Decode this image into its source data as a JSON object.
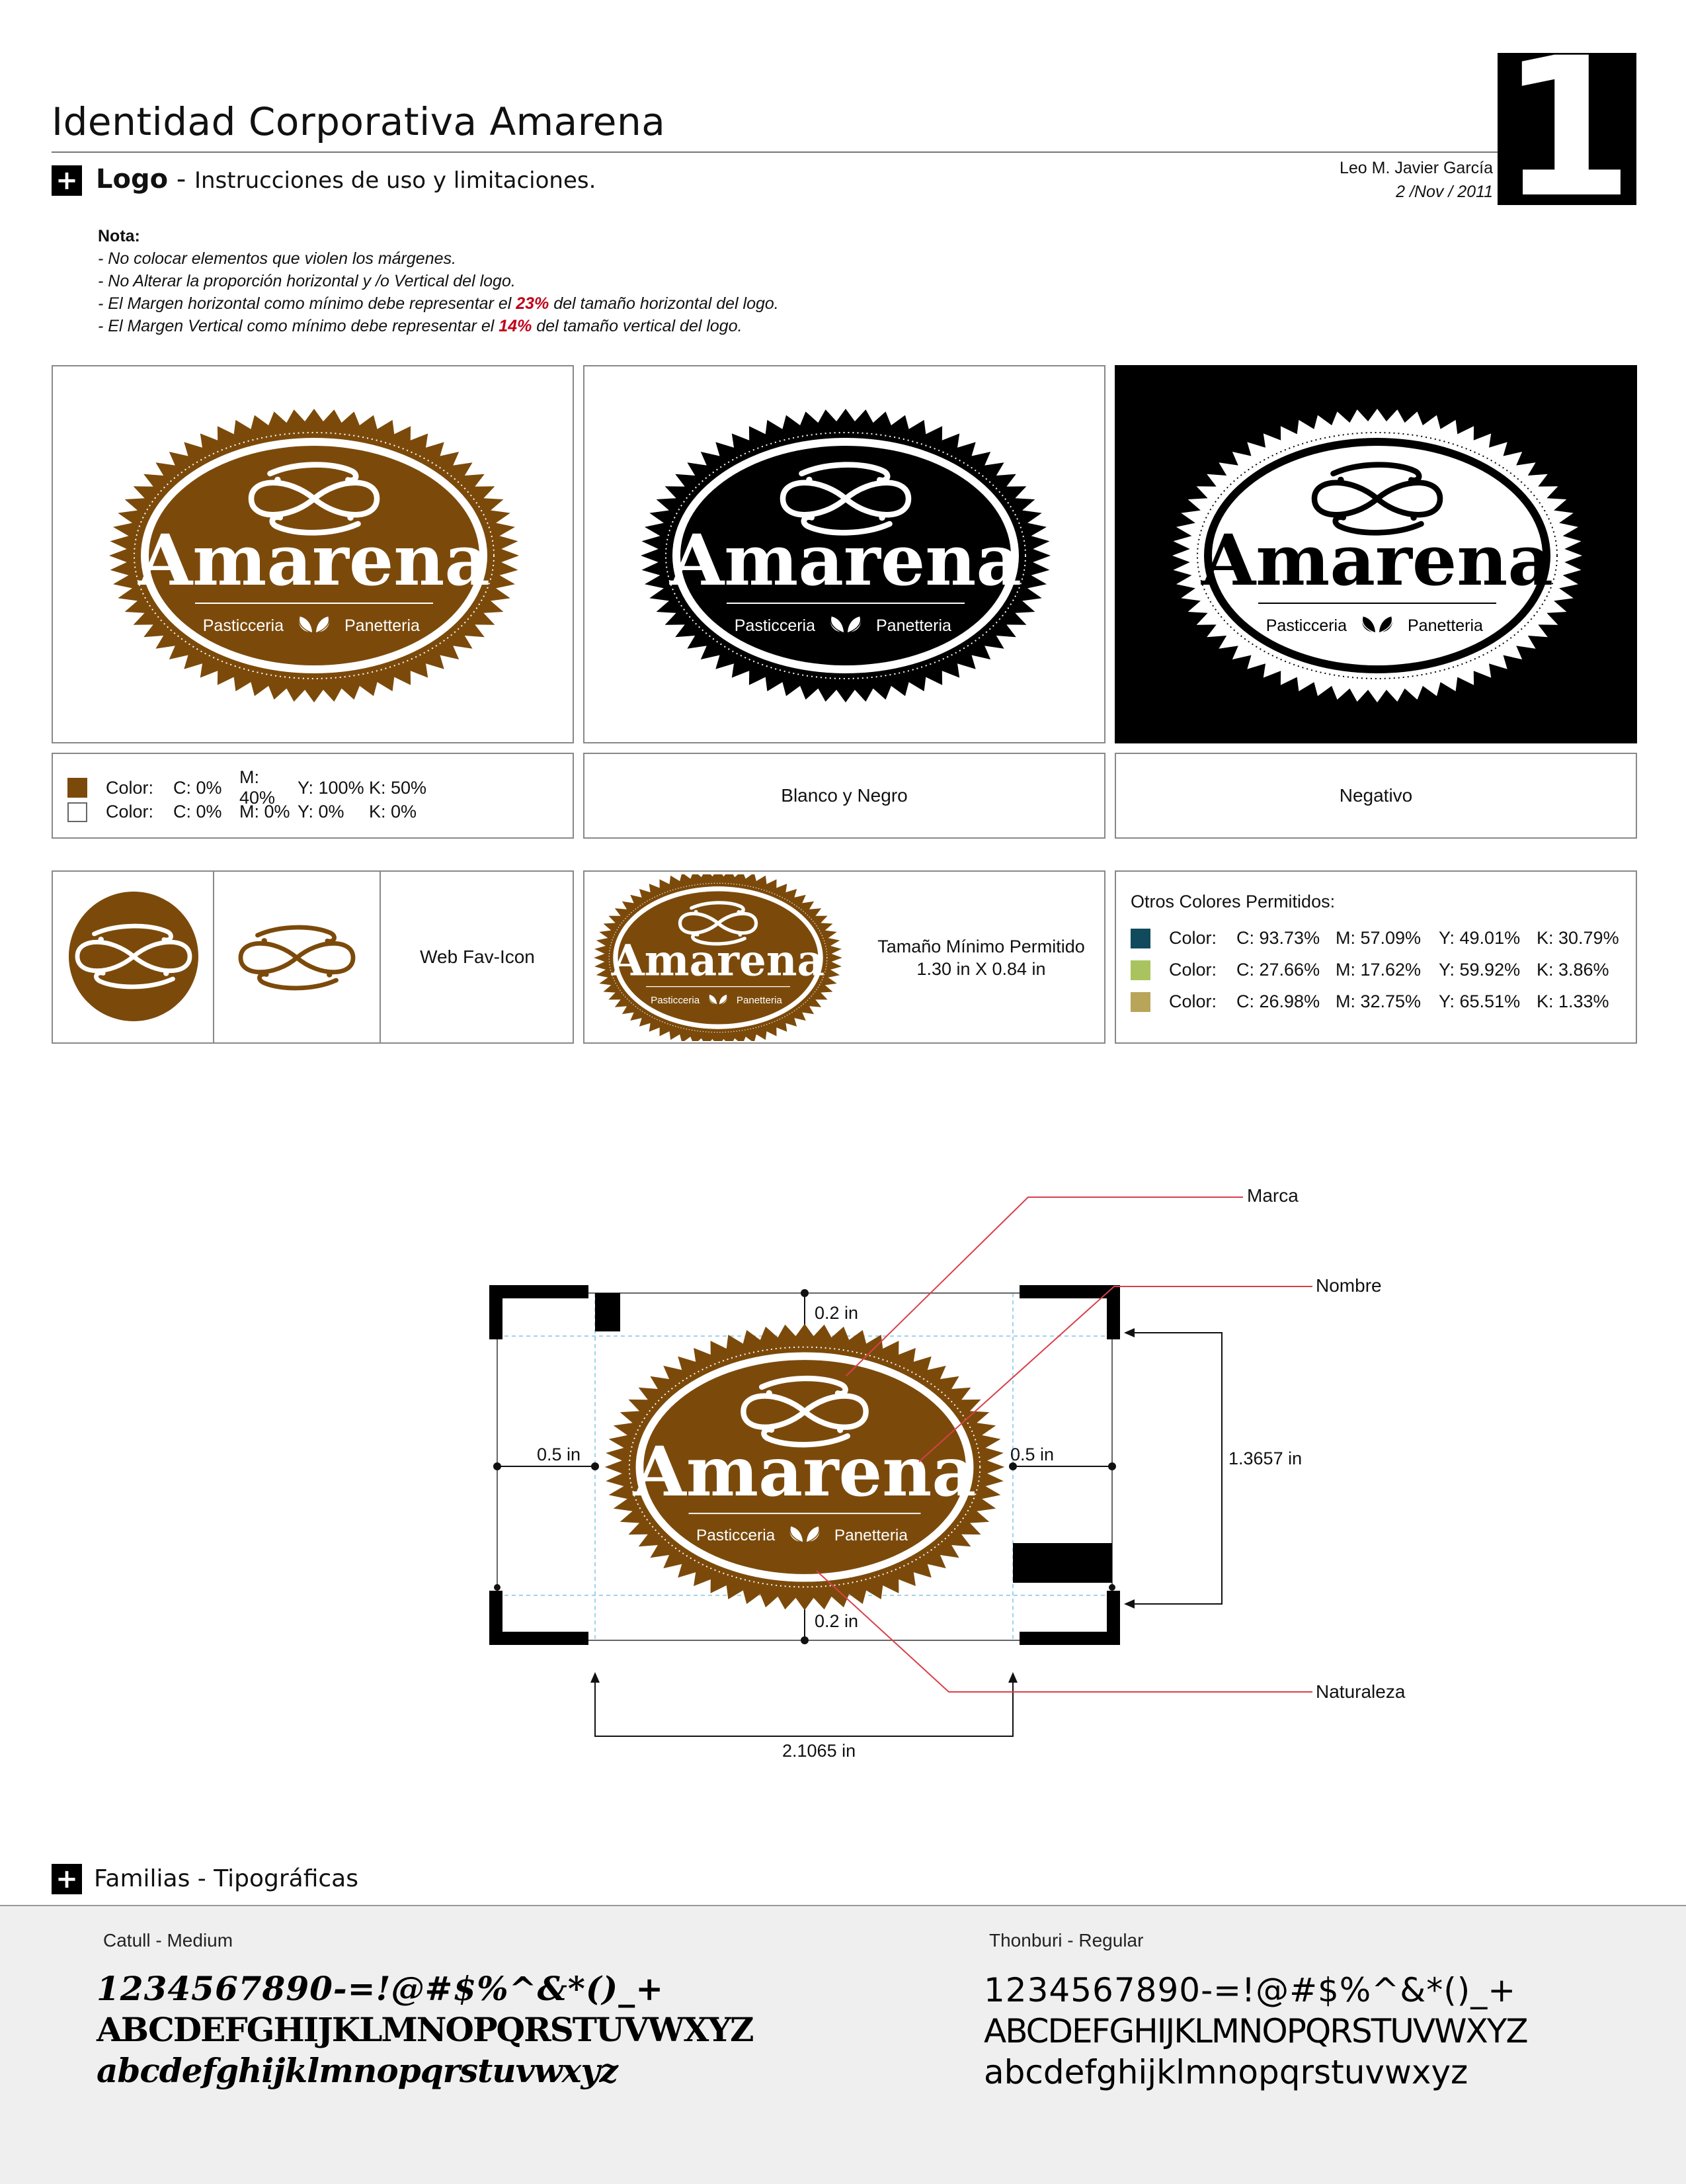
{
  "header": {
    "title": "Identidad Corporativa Amarena",
    "page_number": "1",
    "author": "Leo M. Javier García",
    "date": "2 /Nov / 2011"
  },
  "logo_section": {
    "label": "Logo",
    "separator": "-",
    "subtitle": "Instrucciones de uso y limitaciones."
  },
  "notes": {
    "heading": "Nota:",
    "line1": "- No colocar elementos que violen los márgenes.",
    "line2": "- No Alterar la proporción horizontal y /o Vertical del logo.",
    "line3_pre": "- El Margen horizontal como mínimo debe representar el ",
    "line3_pct": "23%",
    "line3_post": " del tamaño horizontal del logo.",
    "line4_pre": "- El Margen Vertical como mínimo debe representar el ",
    "line4_pct": "14%",
    "line4_post": " del tamaño vertical del logo."
  },
  "logo": {
    "name": "Amarena",
    "left_word": "Pasticceria",
    "right_word": "Panetteria"
  },
  "colors": {
    "brand": "#7b4a0b",
    "brand_label": "Color:",
    "rows": [
      {
        "swatch": "#7b4a0b",
        "label": "Color:",
        "c": "C: 0%",
        "m": "M: 40%",
        "y": "Y: 100%",
        "k": "K: 50%"
      },
      {
        "swatch": "#ffffff",
        "label": "Color:",
        "c": "C: 0%",
        "m": "M: 0%",
        "y": "Y: 0%",
        "k": "K: 0%"
      }
    ]
  },
  "captions": {
    "bw": "Blanco y Negro",
    "negative": "Negativo",
    "favicon": "Web Fav-Icon",
    "min_size_1": "Tamaño Mínimo Permitido",
    "min_size_2": "1.30 in X 0.84 in"
  },
  "other_colors": {
    "title": "Otros Colores Permitidos:",
    "rows": [
      {
        "swatch": "#114a5c",
        "label": "Color:",
        "c": "C: 93.73%",
        "m": "M: 57.09%",
        "y": "Y: 49.01%",
        "k": "K: 30.79%"
      },
      {
        "swatch": "#a9c45e",
        "label": "Color:",
        "c": "C: 27.66%",
        "m": "M: 17.62%",
        "y": "Y: 59.92%",
        "k": "K: 3.86%"
      },
      {
        "swatch": "#b8a55a",
        "label": "Color:",
        "c": "C: 26.98%",
        "m": "M: 32.75%",
        "y": "Y: 65.51%",
        "k": "K: 1.33%"
      }
    ]
  },
  "diagram": {
    "top_margin": "0.2 in",
    "bottom_margin": "0.2 in",
    "left_margin": "0.5 in",
    "right_margin": "0.5 in",
    "height": "1.3657 in",
    "width": "2.1065 in",
    "callout_marca": "Marca",
    "callout_nombre": "Nombre",
    "callout_naturaleza": "Naturaleza"
  },
  "typography": {
    "section_title": "Familias - Tipográficas",
    "font1_name": "Catull - Medium",
    "font2_name": "Thonburi - Regular",
    "numbers": "1234567890-=!@#$%^&*()_+",
    "upper": "ABCDEFGHIJKLMNOPQRSTUVWXYZ",
    "lower": "abcdefghijklmnopqrstuvwxyz"
  }
}
